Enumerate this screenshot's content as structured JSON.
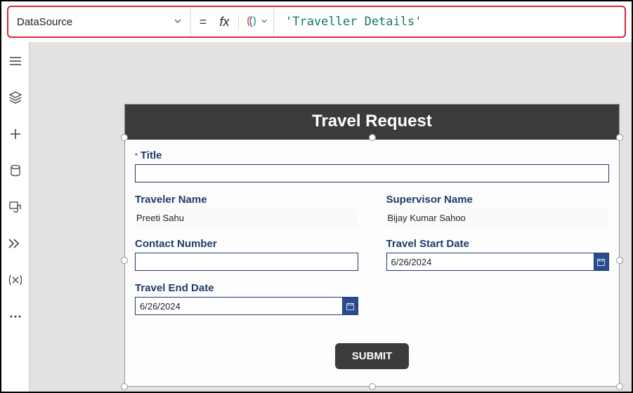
{
  "formula_bar": {
    "property": "DataSource",
    "eq": "=",
    "fx": "fx",
    "expression": "'Traveller Details'"
  },
  "form": {
    "header": "Travel Request",
    "fields": {
      "title": {
        "label": "Title",
        "value": ""
      },
      "traveler_name": {
        "label": "Traveler Name",
        "value": "Preeti Sahu"
      },
      "supervisor_name": {
        "label": "Supervisor Name",
        "value": "Bijay Kumar Sahoo"
      },
      "contact_number": {
        "label": "Contact Number",
        "value": ""
      },
      "travel_start": {
        "label": "Travel Start Date",
        "value": "6/26/2024"
      },
      "travel_end": {
        "label": "Travel End Date",
        "value": "6/26/2024"
      }
    },
    "submit_label": "SUBMIT"
  }
}
